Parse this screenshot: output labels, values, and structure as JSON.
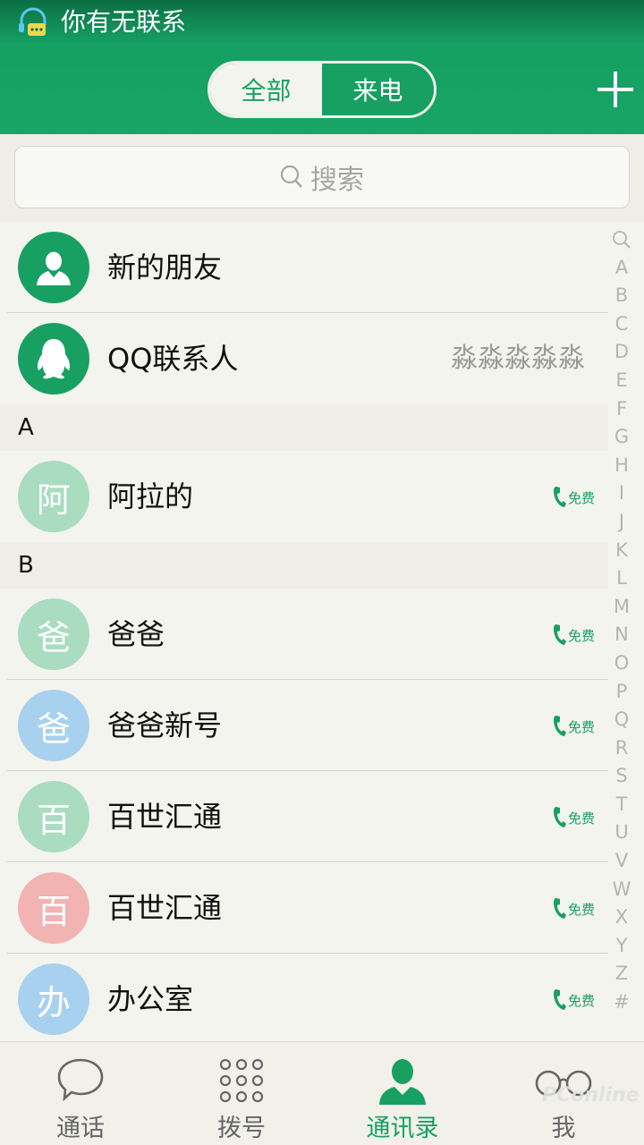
{
  "status_bar": {
    "title": "你有无联系"
  },
  "header": {
    "tabs": [
      {
        "label": "全部",
        "active": true
      },
      {
        "label": "来电",
        "active": false
      }
    ],
    "add_icon": "plus-icon"
  },
  "search": {
    "placeholder": "搜索",
    "icon": "search-icon"
  },
  "special_rows": [
    {
      "name": "新的朋友",
      "icon": "person-icon",
      "extra": ""
    },
    {
      "name": "QQ联系人",
      "icon": "qq-penguin-icon",
      "extra": "淼淼淼淼淼"
    }
  ],
  "sections": [
    {
      "letter": "A",
      "contacts": [
        {
          "avatar_char": "阿",
          "name": "阿拉的",
          "avatar_color": "#a9dcc0",
          "badge": "免费"
        }
      ]
    },
    {
      "letter": "B",
      "contacts": [
        {
          "avatar_char": "爸",
          "name": "爸爸",
          "avatar_color": "#a9dcc0",
          "badge": "免费"
        },
        {
          "avatar_char": "爸",
          "name": "爸爸新号",
          "avatar_color": "#a8d1ef",
          "badge": "免费"
        },
        {
          "avatar_char": "百",
          "name": "百世汇通",
          "avatar_color": "#a9dcc0",
          "badge": "免费"
        },
        {
          "avatar_char": "百",
          "name": "百世汇通",
          "avatar_color": "#f2b3b3",
          "badge": "免费"
        },
        {
          "avatar_char": "办",
          "name": "办公室",
          "avatar_color": "#a8d1ef",
          "badge": "免费"
        }
      ]
    }
  ],
  "index_letters": [
    "A",
    "B",
    "C",
    "D",
    "E",
    "F",
    "G",
    "H",
    "I",
    "J",
    "K",
    "L",
    "M",
    "N",
    "O",
    "P",
    "Q",
    "R",
    "S",
    "T",
    "U",
    "V",
    "W",
    "X",
    "Y",
    "Z",
    "#"
  ],
  "bottom_nav": [
    {
      "label": "通话",
      "icon": "chat-bubble-icon",
      "active": false
    },
    {
      "label": "拨号",
      "icon": "dialpad-icon",
      "active": false
    },
    {
      "label": "通讯录",
      "icon": "contacts-icon",
      "active": true
    },
    {
      "label": "我",
      "icon": "glasses-icon",
      "active": false
    }
  ],
  "watermark": "PConline",
  "colors": {
    "brand_green": "#17a062",
    "header_dark": "#0c6e44",
    "background": "#f4f4ee"
  }
}
